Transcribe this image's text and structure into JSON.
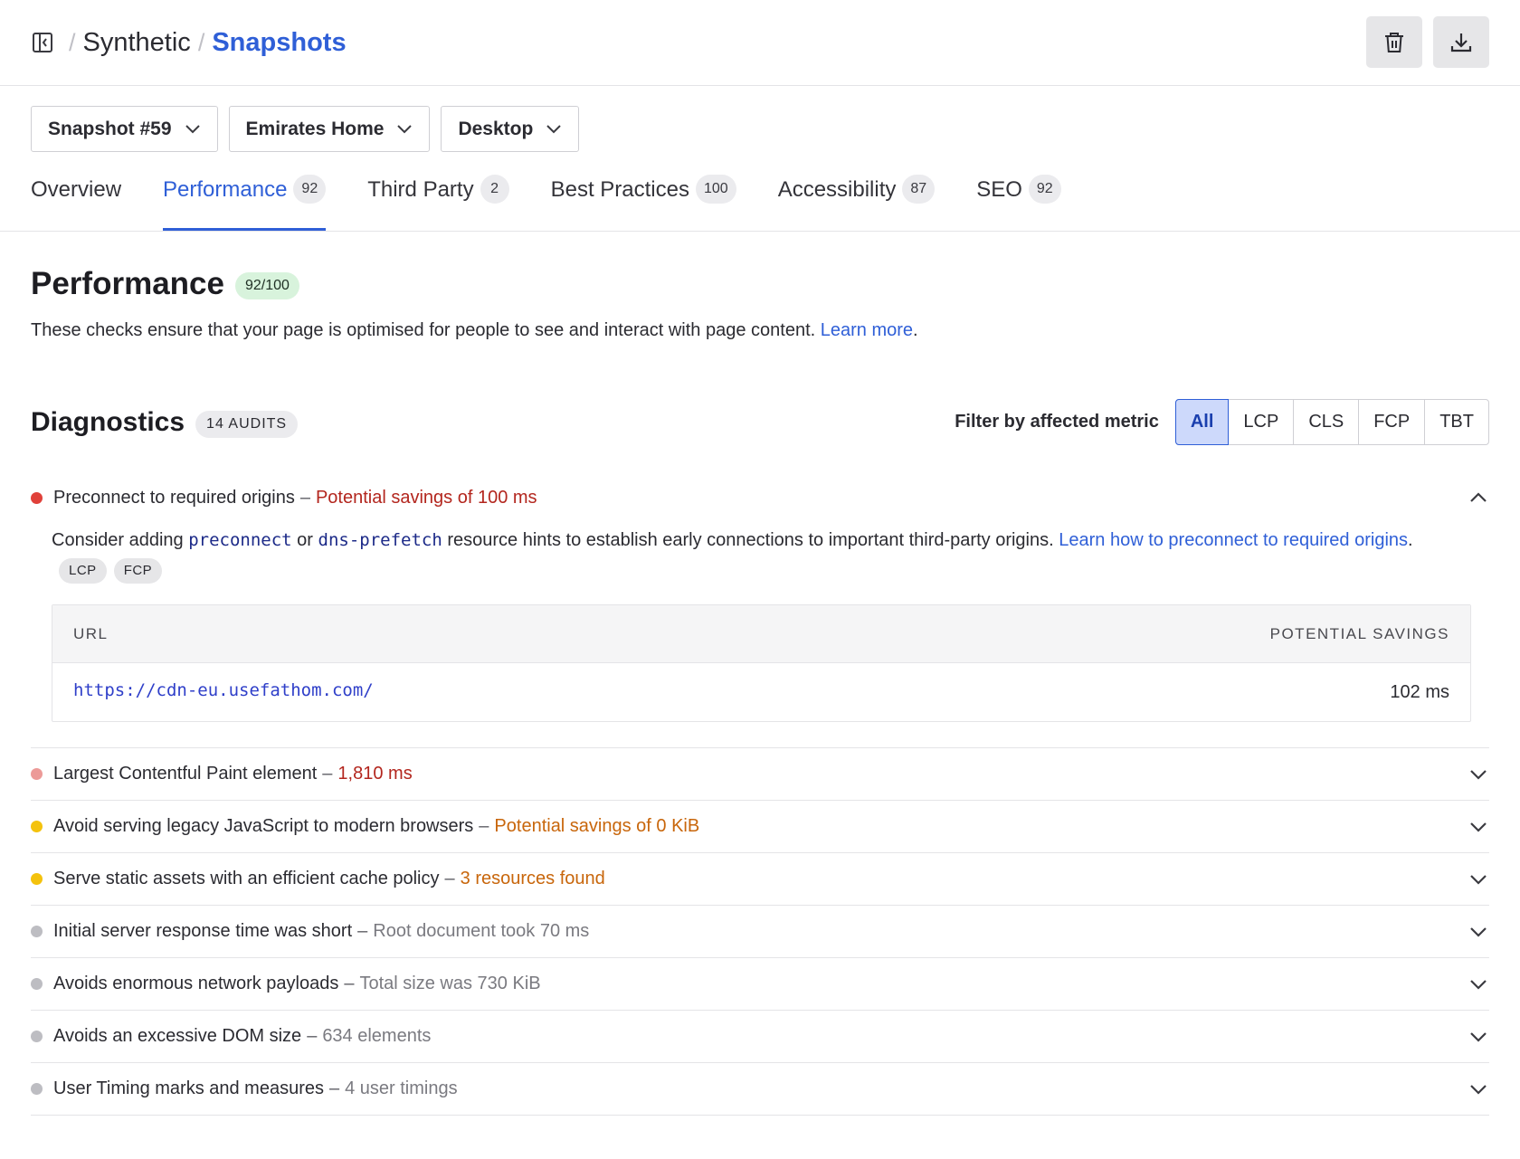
{
  "breadcrumb": {
    "parent": "Synthetic",
    "current": "Snapshots",
    "separator": "/"
  },
  "header_actions": [
    "trash-icon",
    "download-icon"
  ],
  "selectors": [
    {
      "label": "Snapshot #59"
    },
    {
      "label": "Emirates Home"
    },
    {
      "label": "Desktop"
    }
  ],
  "tabs": [
    {
      "label": "Overview",
      "count": null,
      "active": false
    },
    {
      "label": "Performance",
      "count": "92",
      "active": true
    },
    {
      "label": "Third Party",
      "count": "2",
      "active": false
    },
    {
      "label": "Best Practices",
      "count": "100",
      "active": false
    },
    {
      "label": "Accessibility",
      "count": "87",
      "active": false
    },
    {
      "label": "SEO",
      "count": "92",
      "active": false
    }
  ],
  "performance": {
    "title": "Performance",
    "score": "92/100",
    "description": "These checks ensure that your page is optimised for people to see and interact with page content.",
    "learn_more": "Learn more",
    "period": "."
  },
  "diagnostics": {
    "title": "Diagnostics",
    "audits_badge": "14 AUDITS",
    "filter_label": "Filter by affected metric",
    "filters": [
      "All",
      "LCP",
      "CLS",
      "FCP",
      "TBT"
    ],
    "active_filter": "All"
  },
  "expanded_audit": {
    "title": "Preconnect to required origins",
    "separator": "–",
    "value": "Potential savings of 100 ms",
    "status_color": "#e0413a",
    "value_color": "#b3261e",
    "text_1": "Consider adding ",
    "code_1": "preconnect",
    "text_2": " or ",
    "code_2": "dns-prefetch",
    "text_3": " resource hints to establish early connections to important third-party origins. ",
    "link": "Learn how to preconnect to required origins",
    "text_4": ".",
    "tags": [
      "LCP",
      "FCP"
    ],
    "table": {
      "col_url": "URL",
      "col_savings": "POTENTIAL SAVINGS",
      "rows": [
        {
          "url": "https://cdn-eu.usefathom.com/",
          "savings": "102 ms"
        }
      ]
    }
  },
  "audits": [
    {
      "title": "Largest Contentful Paint element",
      "value": "1,810 ms",
      "dot": "#ec9a98",
      "value_color": "#b3261e"
    },
    {
      "title": "Avoid serving legacy JavaScript to modern browsers",
      "value": "Potential savings of 0 KiB",
      "dot": "#f4c20d",
      "value_color": "#c8660b"
    },
    {
      "title": "Serve static assets with an efficient cache policy",
      "value": "3 resources found",
      "dot": "#f4c20d",
      "value_color": "#c8660b"
    },
    {
      "title": "Initial server response time was short",
      "value": "Root document took 70 ms",
      "dot": "#bdbdc2",
      "value_color": "#7a7a80"
    },
    {
      "title": "Avoids enormous network payloads",
      "value": "Total size was 730 KiB",
      "dot": "#bdbdc2",
      "value_color": "#7a7a80"
    },
    {
      "title": "Avoids an excessive DOM size",
      "value": "634 elements",
      "dot": "#bdbdc2",
      "value_color": "#7a7a80"
    },
    {
      "title": "User Timing marks and measures",
      "value": "4 user timings",
      "dot": "#bdbdc2",
      "value_color": "#7a7a80"
    }
  ]
}
